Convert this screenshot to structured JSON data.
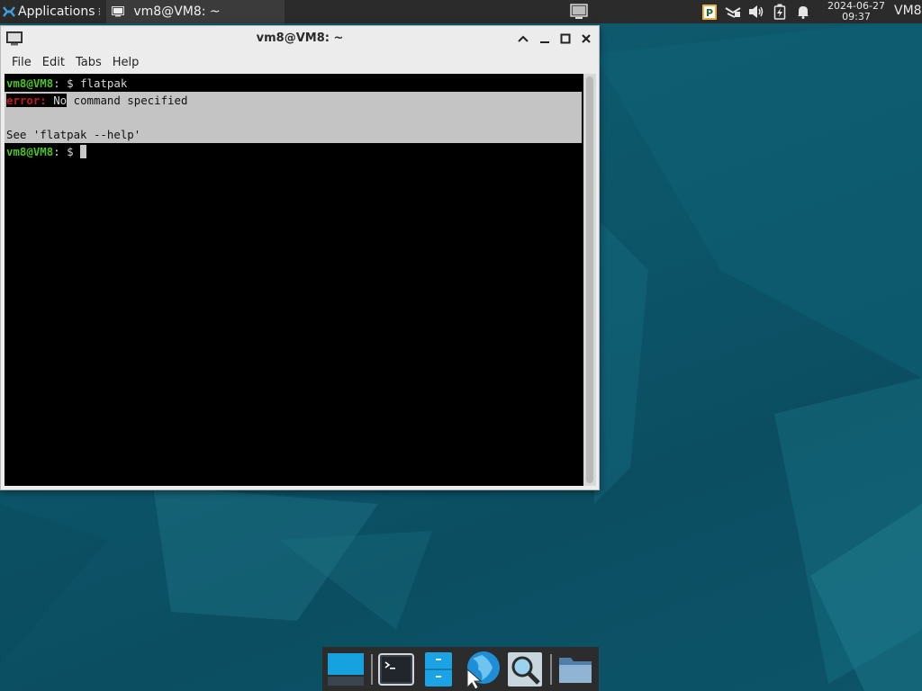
{
  "top_panel": {
    "apps_menu_label": "Applications",
    "taskbar_window_label": "vm8@VM8: ~",
    "clock_date": "2024-06-27",
    "clock_time": "09:37",
    "user": "VM8"
  },
  "window": {
    "title": "vm8@VM8: ~",
    "menu": [
      "File",
      "Edit",
      "Tabs",
      "Help"
    ]
  },
  "terminal": {
    "prompt": "vm8@VM8",
    "prompt_suffix": ": $ ",
    "command": "flatpak",
    "error_label": "error:",
    "error_message_first": " No",
    "error_message_rest": " command specified",
    "help_hint": "See 'flatpak --help'"
  },
  "colors": {
    "prompt_green": "#4ac31f",
    "error_red": "#c41a1a",
    "panel_bg": "#2b2b2b",
    "dock_bg": "#2c2c2c"
  },
  "dock_icons": [
    "show-desktop-icon",
    "terminal-icon",
    "file-manager-icon",
    "web-browser-icon",
    "app-finder-icon",
    "folder-icon"
  ]
}
